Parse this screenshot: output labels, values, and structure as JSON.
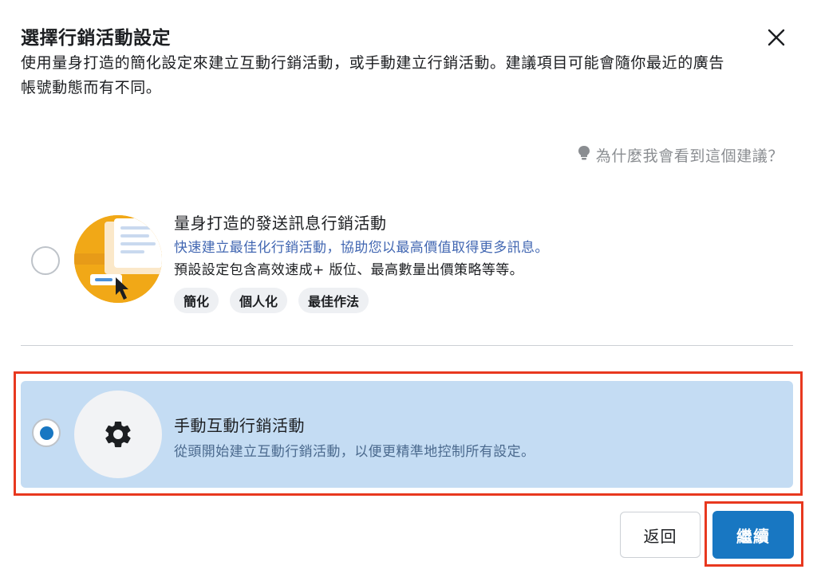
{
  "dialog": {
    "title": "選擇行銷活動設定",
    "description": "使用量身打造的簡化設定來建立互動行銷活動，或手動建立行銷活動。建議項目可能會隨你最近的廣告帳號動態而有不同。",
    "hint": "為什麼我會看到這個建議？"
  },
  "options": [
    {
      "title": "量身打造的發送訊息行銷活動",
      "subtitle": "快速建立最佳化行銷活動，協助您以最高價值取得更多訊息。",
      "detail": "預設設定包含高效速成+ 版位、最高數量出價策略等等。",
      "tags": [
        "簡化",
        "個人化",
        "最佳作法"
      ],
      "selected": false
    },
    {
      "title": "手動互動行銷活動",
      "subtitle": "從頭開始建立互動行銷活動，以便更精準地控制所有設定。",
      "selected": true
    }
  ],
  "buttons": {
    "back": "返回",
    "continue": "繼續"
  },
  "icons": {
    "close": "close-icon",
    "hint": "lightbulb-icon",
    "option2": "gear-icon"
  },
  "colors": {
    "primary": "#1877c2",
    "selected_bg": "#c4dcf3",
    "highlight": "#e8381f"
  }
}
